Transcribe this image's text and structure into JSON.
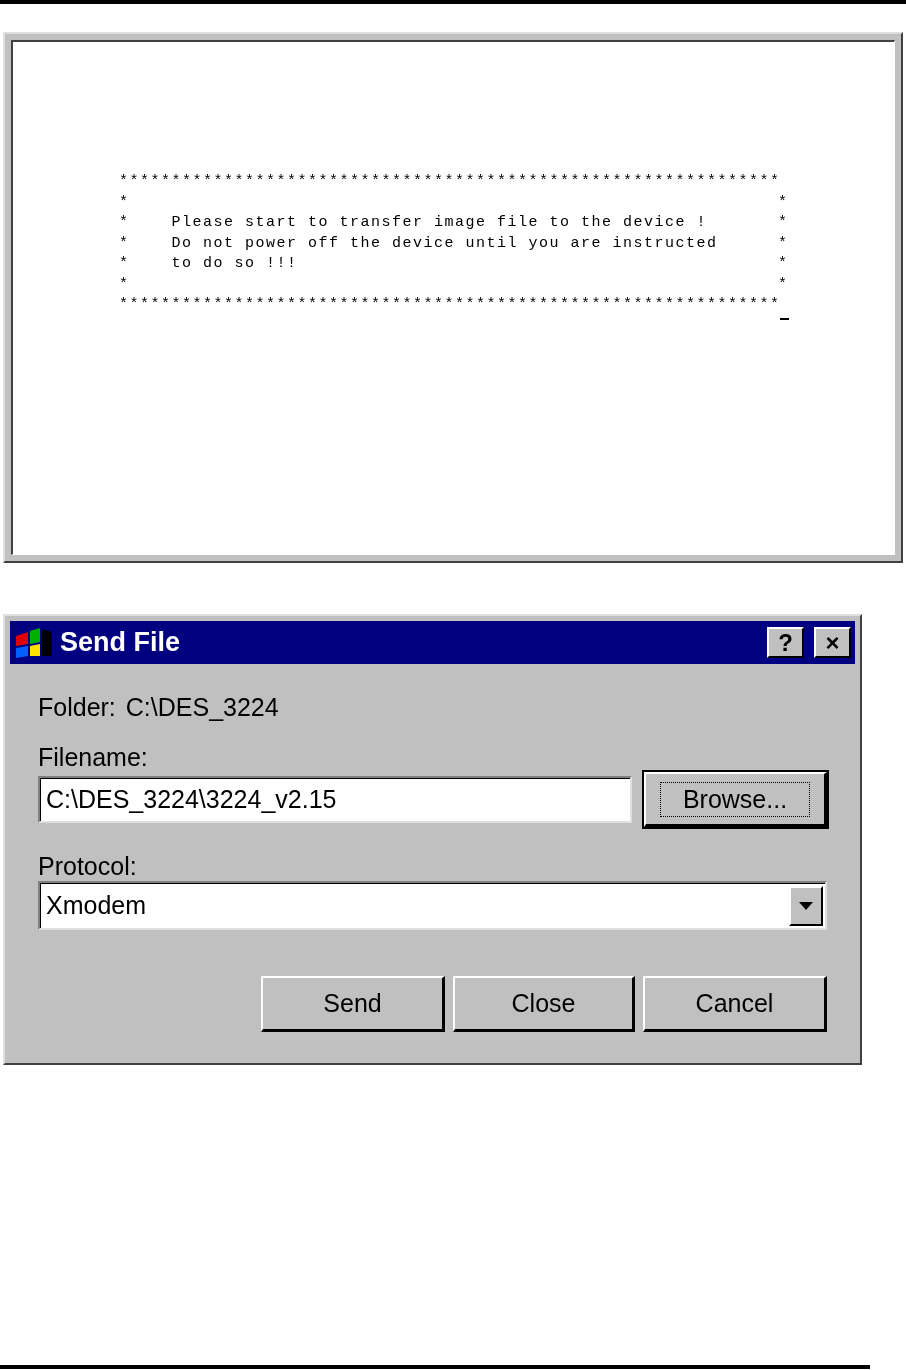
{
  "terminal": {
    "lines": [
      {
        "kind": "rule",
        "text": "***************************************************************"
      },
      {
        "kind": "framed",
        "left": "*",
        "right": "*"
      },
      {
        "kind": "framed",
        "left": "*",
        "text": "Please start to transfer image file to the device !",
        "right": "*"
      },
      {
        "kind": "framed",
        "left": "*",
        "text": "Do not power off the device until you are instructed",
        "right": "*"
      },
      {
        "kind": "framed",
        "left": "*",
        "text": "to do so !!!",
        "right": "*"
      },
      {
        "kind": "framed",
        "left": "*",
        "right": "*"
      },
      {
        "kind": "rule",
        "text": "***************************************************************"
      }
    ],
    "cursor": true
  },
  "dialog": {
    "title": "Send File",
    "title_buttons": [
      "?",
      "×"
    ],
    "folder_label": "Folder:",
    "folder_value": "C:\\DES_3224",
    "filename_label": "Filename:",
    "filename_value": "C:\\DES_3224\\3224_v2.15",
    "browse": {
      "label": "Browse...",
      "focused": true
    },
    "protocol_label": "Protocol:",
    "protocol_value": "Xmodem",
    "buttons": [
      {
        "label": "Send",
        "focused": false
      },
      {
        "label": "Close",
        "focused": false
      },
      {
        "label": "Cancel",
        "focused": false
      }
    ]
  }
}
